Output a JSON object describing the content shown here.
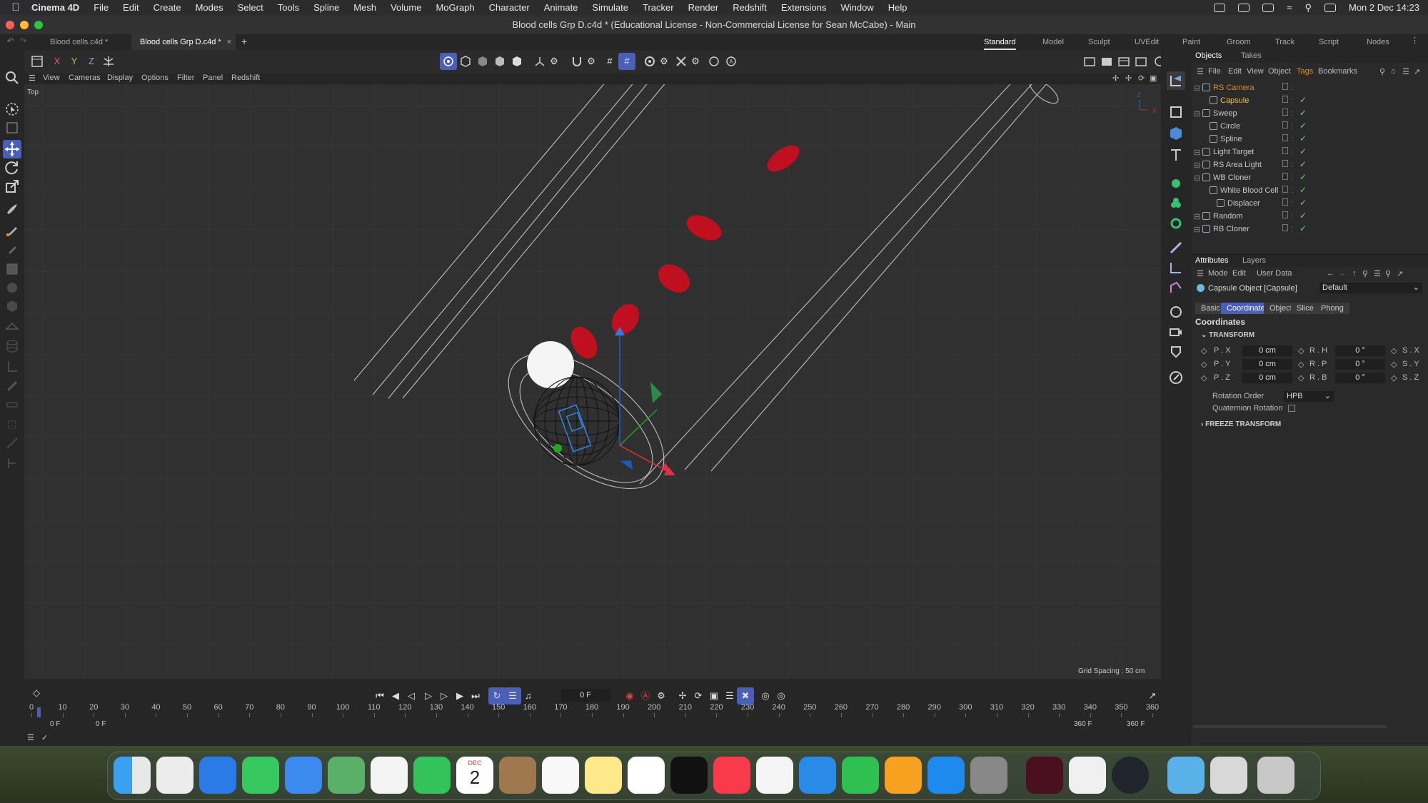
{
  "menubar": {
    "app": "Cinema 4D",
    "items": [
      "File",
      "Edit",
      "Create",
      "Modes",
      "Select",
      "Tools",
      "Spline",
      "Mesh",
      "Volume",
      "MoGraph",
      "Character",
      "Animate",
      "Simulate",
      "Tracker",
      "Render",
      "Redshift",
      "Extensions",
      "Window",
      "Help"
    ],
    "clock": "Mon 2 Dec  14:23"
  },
  "window": {
    "title": "Blood cells Grp D.c4d * (Educational License - Non-Commercial License for Sean McCabe) - Main"
  },
  "doc_tabs": [
    "Blood cells.c4d *",
    "Blood cells Grp D.c4d *"
  ],
  "layouts": [
    "Standard",
    "Model",
    "Sculpt",
    "UVEdit",
    "Paint",
    "Groom",
    "Track",
    "Script",
    "Nodes"
  ],
  "axes": {
    "x": "X",
    "y": "Y",
    "z": "Z"
  },
  "viewport": {
    "menu": [
      "View",
      "Cameras",
      "Display",
      "Options",
      "Filter",
      "Panel",
      "Redshift"
    ],
    "view_name": "Top",
    "grid_spacing": "Grid Spacing : 50 cm"
  },
  "objects": {
    "tabs": [
      "Objects",
      "Takes"
    ],
    "menu": [
      "File",
      "Edit",
      "View",
      "Object",
      "Tags",
      "Bookmarks"
    ],
    "items": [
      {
        "name": "RS Camera",
        "indent": 0,
        "color": "#e08a2a"
      },
      {
        "name": "Capsule",
        "indent": 1,
        "color": "#f0c23a"
      },
      {
        "name": "Sweep",
        "indent": 0,
        "color": "#c8c8c8"
      },
      {
        "name": "Circle",
        "indent": 1,
        "color": "#c8c8c8"
      },
      {
        "name": "Spline",
        "indent": 1,
        "color": "#c8c8c8"
      },
      {
        "name": "Light Target",
        "indent": 0,
        "color": "#c8c8c8"
      },
      {
        "name": "RS Area Light",
        "indent": 0,
        "color": "#c8c8c8"
      },
      {
        "name": "WB Cloner",
        "indent": 0,
        "color": "#c8c8c8"
      },
      {
        "name": "White Blood Cell",
        "indent": 1,
        "color": "#c8c8c8"
      },
      {
        "name": "Displacer",
        "indent": 2,
        "color": "#c8c8c8"
      },
      {
        "name": "Random",
        "indent": 0,
        "color": "#c8c8c8"
      },
      {
        "name": "RB Cloner",
        "indent": 0,
        "color": "#c8c8c8"
      }
    ]
  },
  "attributes": {
    "tabs": [
      "Attributes",
      "Layers"
    ],
    "menu": [
      "Mode",
      "Edit",
      "User Data"
    ],
    "object": "Capsule Object [Capsule]",
    "preset": "Default",
    "subtabs": [
      "Basic",
      "Coordinates",
      "Object",
      "Slice",
      "Phong"
    ],
    "section": "Coordinates",
    "group": "TRANSFORM",
    "rows": [
      {
        "pl": "P . X",
        "pv": "0 cm",
        "rl": "R . H",
        "rv": "0 °",
        "sl": "S . X"
      },
      {
        "pl": "P . Y",
        "pv": "0 cm",
        "rl": "R . P",
        "rv": "0 °",
        "sl": "S . Y"
      },
      {
        "pl": "P . Z",
        "pv": "0 cm",
        "rl": "R . B",
        "rv": "0 °",
        "sl": "S . Z"
      }
    ],
    "rotation_order_label": "Rotation Order",
    "rotation_order": "HPB",
    "quaternion_label": "Quaternion Rotation",
    "freeze": "FREEZE TRANSFORM"
  },
  "timeline": {
    "current": "0 F",
    "start": "0 F",
    "start2": "0 F",
    "end": "360 F",
    "end2": "360 F",
    "ruler": [
      "0",
      "10",
      "20",
      "30",
      "40",
      "50",
      "60",
      "70",
      "80",
      "90",
      "100",
      "110",
      "120",
      "130",
      "140",
      "150",
      "160",
      "170",
      "180",
      "190",
      "200",
      "210",
      "220",
      "230",
      "240",
      "250",
      "260",
      "270",
      "280",
      "290",
      "300",
      "310",
      "320",
      "330",
      "340",
      "350",
      "360"
    ]
  },
  "dock": {
    "calendar_month": "DEC",
    "calendar_day": "2"
  }
}
